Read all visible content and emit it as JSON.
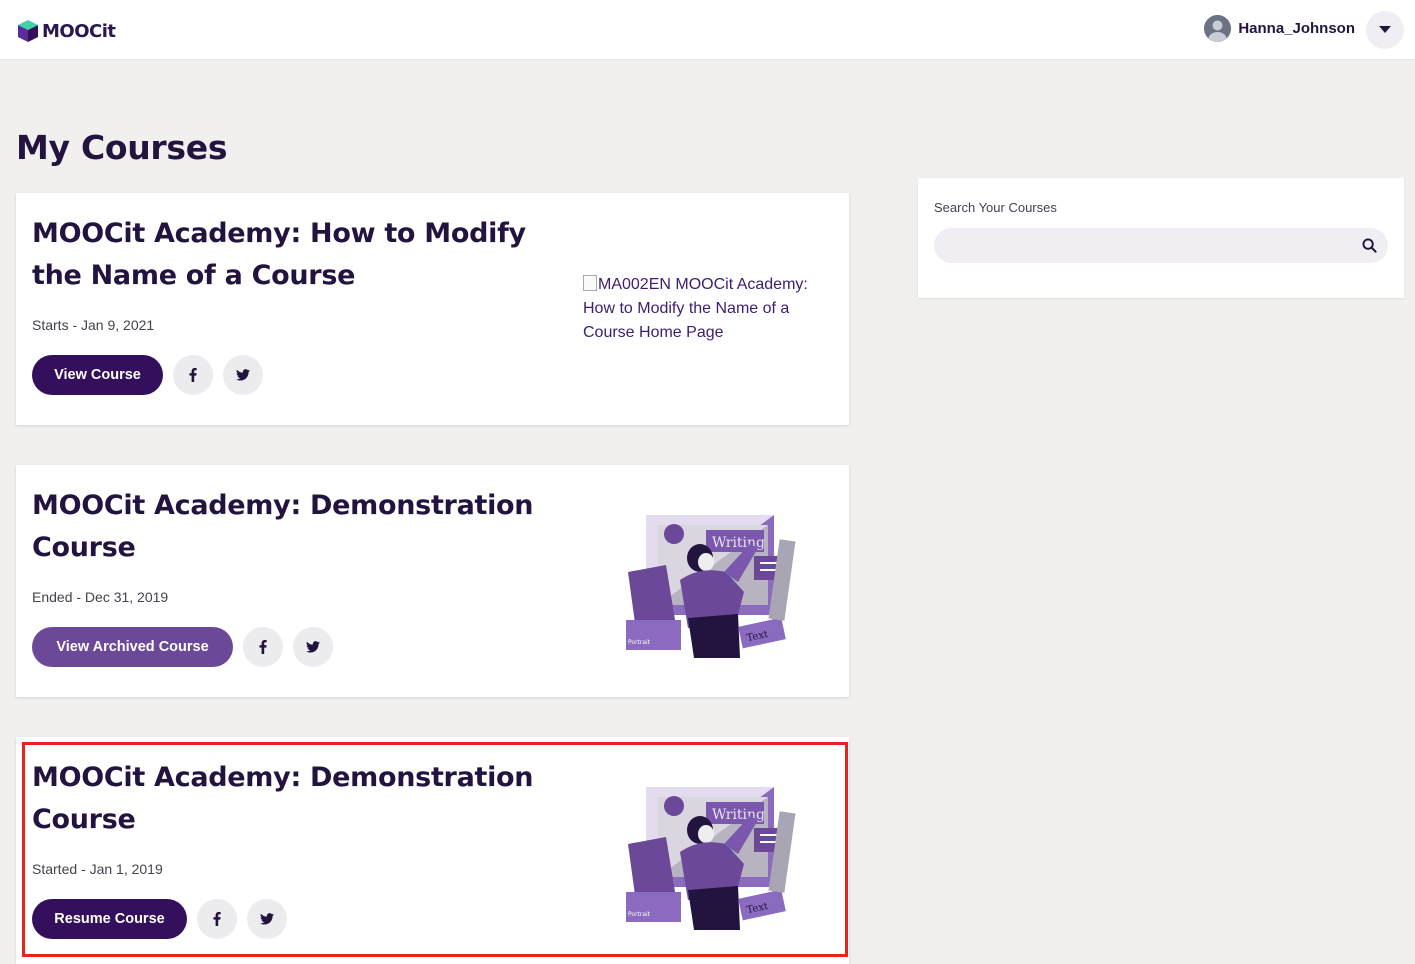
{
  "header": {
    "logo_text": "MOOCit",
    "username": "Hanna_Johnson"
  },
  "page_title": "My Courses",
  "courses": [
    {
      "title": "MOOCit Academy: How to Modify the Name of a Course",
      "date": "Starts - Jan 9, 2021",
      "action_label": "View Course",
      "image_alt": "MA002EN MOOCit Academy: How to Modify the Name of a Course Home Page"
    },
    {
      "title": "MOOCit Academy: Demonstration Course",
      "date": "Ended - Dec 31, 2019",
      "action_label": "View Archived Course"
    },
    {
      "title": "MOOCit Academy: Demonstration Course",
      "date": "Started - Jan 1, 2019",
      "action_label": "Resume Course"
    }
  ],
  "search": {
    "label": "Search Your Courses",
    "placeholder": ""
  },
  "illustration_text": {
    "board_label": "Writing",
    "card_label": "Text",
    "panel_label": "Portrait"
  },
  "colors": {
    "brand_dark": "#34105c",
    "brand_light": "#6c4899",
    "highlight": "#e8231b"
  },
  "icons": [
    "moocit-logo-icon",
    "user-avatar-icon",
    "chevron-down-icon",
    "facebook-icon",
    "twitter-icon",
    "search-icon"
  ]
}
